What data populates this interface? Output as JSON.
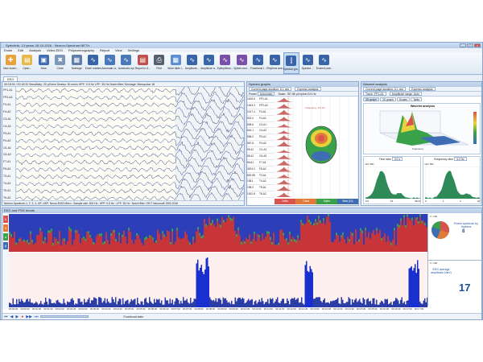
{
  "window": {
    "title": "Sytechnik, 13 years, 06.10.2016 - Neuron-Spectrum.NET/v"
  },
  "menu": [
    "Exam",
    "Edit",
    "Analysis",
    "Video-EEG",
    "Polysomnography",
    "Report",
    "View",
    "Settings"
  ],
  "toolbar": [
    {
      "label": "New exam...",
      "icon": "new-exam-icon",
      "color": "#e9a23b"
    },
    {
      "label": "Open...",
      "icon": "open-folder-icon",
      "color": "#e8b84a"
    },
    {
      "label": "Save",
      "icon": "save-icon",
      "color": "#3f6db3"
    },
    {
      "label": "Close",
      "icon": "close-file-icon",
      "color": "#7d97b9"
    },
    {
      "label": "Montage",
      "icon": "montage-icon",
      "color": "#5e7fa8"
    },
    {
      "label": "Event markers",
      "icon": "event-markers-icon",
      "color": "#3a64a8"
    },
    {
      "label": "Automatic a...",
      "icon": "automatic-analysis-icon",
      "color": "#4a78b8"
    },
    {
      "label": "Automatic epo...",
      "icon": "automatic-epoch-icon",
      "color": "#4a78b8"
    },
    {
      "label": "Report to d...",
      "icon": "report-icon",
      "color": "#c0504d"
    },
    {
      "label": "Print",
      "icon": "print-icon",
      "color": "#55606e"
    },
    {
      "label": "Work table i...",
      "icon": "work-table-icon",
      "color": "#5b8fd0"
    },
    {
      "label": "Amplitude...",
      "icon": "amplitude-icon",
      "color": "#3a64a8"
    },
    {
      "label": "Amplitude a...",
      "icon": "amplitude-analysis-icon",
      "color": "#3a64a8"
    },
    {
      "label": "Epileptiform...",
      "icon": "epileptiform-icon",
      "color": "#7a4fa8"
    },
    {
      "label": "Spikes and ...",
      "icon": "spikes-icon",
      "color": "#7a4fa8"
    },
    {
      "label": "Functional t...",
      "icon": "functional-tests-icon",
      "color": "#3a64a8"
    },
    {
      "label": "Rhythms ana...",
      "icon": "rhythms-icon",
      "color": "#3a64a8"
    },
    {
      "label": "Spectral gra...",
      "icon": "spectral-graph-icon",
      "color": "#3a64a8"
    },
    {
      "label": "Spectra ...",
      "icon": "spectra-icon",
      "color": "#3a64a8"
    },
    {
      "label": "Evoked pote...",
      "icon": "evoked-potentials-icon",
      "color": "#3a64a8"
    }
  ],
  "toolbar_active_index": 17,
  "tab": "EEG",
  "eeg": {
    "controls": "00:18:04 / 00:18:32   Sensitivity: 20 µV/mm   Sweep: 30 mm/s   HPF: 0.5 Hz   LPF: 35 Hz   Notch filter:   Montage: Monopolar 18",
    "channels": [
      "FP1-A1",
      "FP2-A2",
      "F3-A1",
      "F4-A2",
      "C3-A1",
      "C4-A2",
      "P3-A1",
      "P4-A2",
      "O1-A1",
      "O2-A2",
      "F7-A1",
      "F8-A2",
      "T3-A1",
      "T4-A2",
      "T5-A1",
      "T6-A2"
    ],
    "status": "Neuron-Spectrum-1, 2, 3, 4, 4/P, 4/EP, Neuro-EMG-Micro : Sample rate: 500 Hz : HPF: 0.5 Hz : LPF: 35 Hz : Notch filter: Off   © Neurosoft 1992-2016"
  },
  "spectra": {
    "title": "Spectra graphs",
    "selector": "Current page duration: 6.1 sec",
    "selector2": "Express analysis",
    "power_label": "Power",
    "power_mode": "Automatic",
    "scale": "Scale: 787.86 µV²/pixel  3.6 Hz",
    "freq_label": "Frequency: 6.6 Hz",
    "channels": [
      "FP1-A1",
      "FP2-A2",
      "F3-A1",
      "F4-A2",
      "C3-A1",
      "C4-A2",
      "P3-A1",
      "P4-A2",
      "O1-A1",
      "O2-A2",
      "F7-A1",
      "F8-A2",
      "T3-A1",
      "T4-A2",
      "T5-A1",
      "T6-A2"
    ],
    "values": [
      "1405.5",
      "1453.3",
      "1017.4",
      "922.0",
      "608.6",
      "616.1",
      "558.0",
      "567.8",
      "99.42",
      "98.42",
      "96.61",
      "3204.0",
      "832.68",
      "1081",
      "198.0",
      "1002.8"
    ],
    "hz_label": "Hz",
    "bands": [
      {
        "name": "Delta",
        "color": "#d9534f"
      },
      {
        "name": "Theta",
        "color": "#e07b39"
      },
      {
        "name": "Alpha",
        "color": "#3aa14b"
      },
      {
        "name": "Beta (10)",
        "color": "#3f6db3"
      }
    ]
  },
  "wavelet": {
    "title": "Wavelet analysis",
    "selector": "Current page duration: 6.1 sec",
    "selector2": "Express analysis",
    "trace": "Trace: FP1-A1",
    "range": "Amplitude range: Auto",
    "tabs": [
      "3D graph",
      "2D graph",
      "Scales",
      "Table"
    ],
    "graph_title": "Wavelet analysis",
    "frequency_label": "Frequency",
    "time_slice": "Time slice",
    "freq_slice": "Frequency slice",
    "time_slice_val": "3.0 s",
    "freq_slice_val": "3.0 Hz",
    "time_axis": [
      "0.5",
      "16",
      "32Hz"
    ],
    "freq_axis": [
      "0",
      "1",
      "2",
      "3s"
    ],
    "ymax": "mkV 891",
    "ymax2": "mkV 891"
  },
  "trends": {
    "title": "EEG and PSG trends",
    "labels_left": [
      "δ",
      "θ",
      "α",
      "β"
    ],
    "ranges": [
      "0...100",
      "0...100"
    ],
    "right_top_title": "Power spectrum by rhythms",
    "right_top_value": "8",
    "right_bottom_title": "EEG average amplitude (mkV)",
    "right_bottom_value": "17",
    "times": [
      "00:00:00",
      "00:00:30",
      "00:01:00",
      "00:01:30",
      "00:02:00",
      "00:02:30",
      "00:03:00",
      "00:03:30",
      "00:04:00",
      "00:04:30",
      "00:05:00",
      "00:05:30",
      "00:06:00",
      "00:06:30",
      "00:07:00",
      "00:07:30",
      "00:08:00",
      "00:08:30",
      "00:09:00",
      "00:09:30",
      "00:10:00",
      "00:10:30",
      "00:11:00",
      "00:11:30",
      "00:12:00",
      "00:12:30",
      "00:13:00",
      "00:13:30",
      "00:14:00",
      "00:14:30",
      "00:15:00",
      "00:15:30",
      "00:16:00",
      "00:16:30",
      "00:17:00",
      "00:17:30"
    ],
    "bottom_label": "Functional tests"
  }
}
